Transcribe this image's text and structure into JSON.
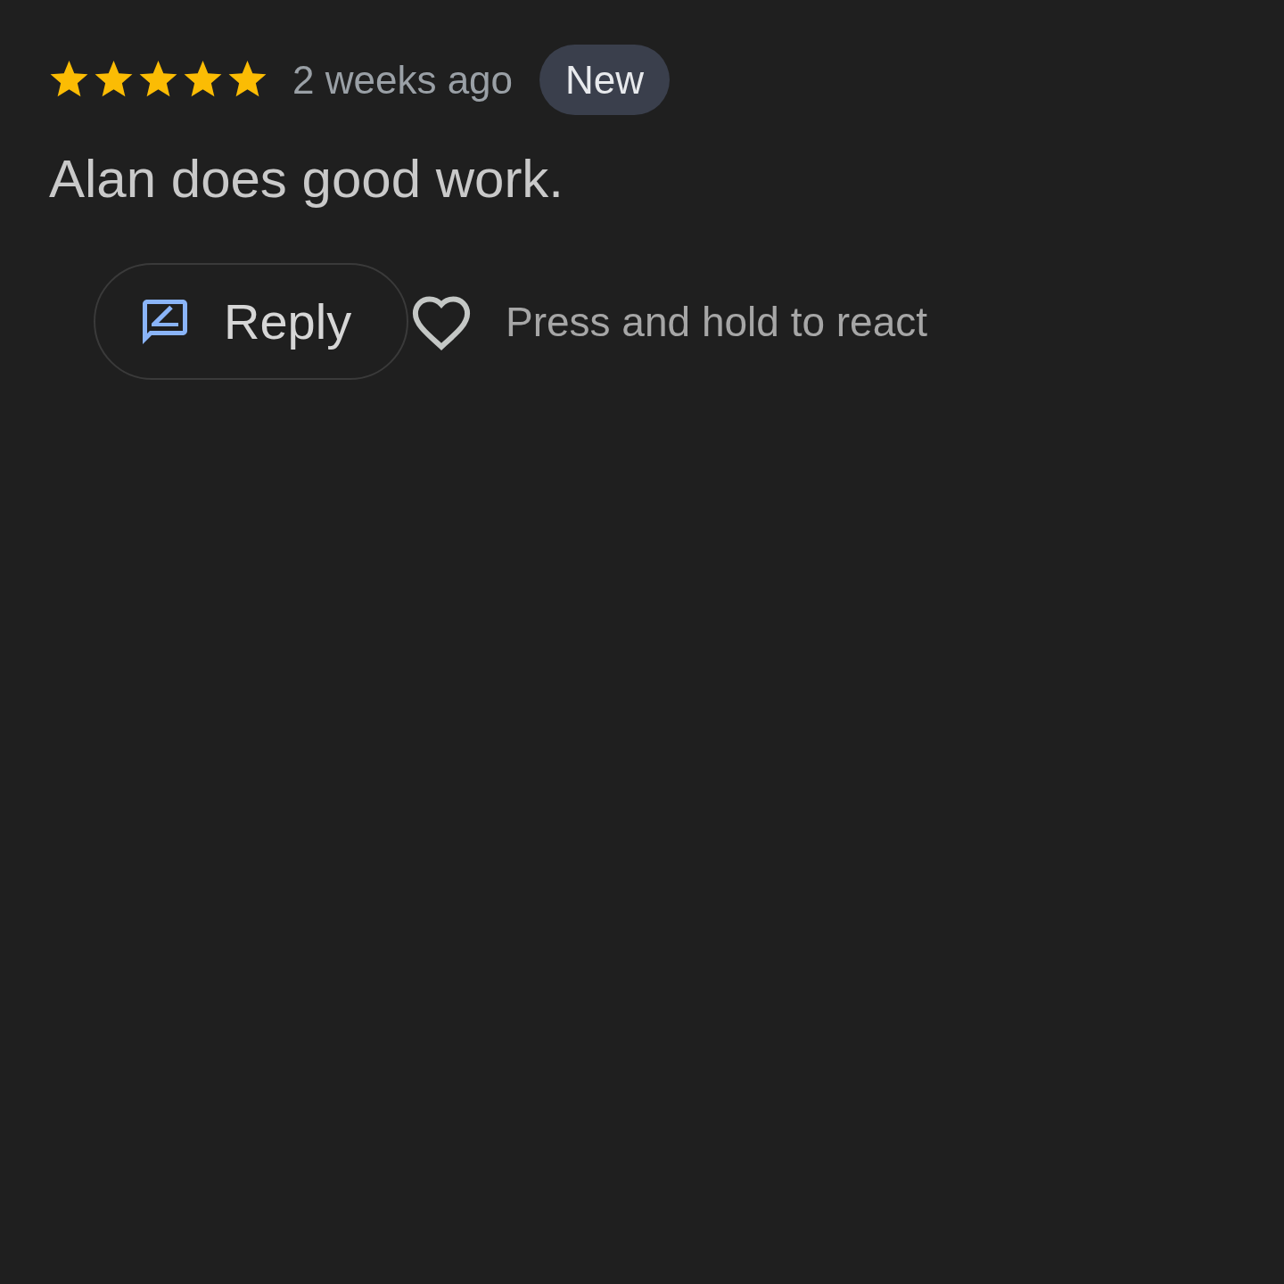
{
  "review": {
    "stars": 5,
    "time": "2 weeks ago",
    "badge": "New",
    "text": "Alan does good work."
  },
  "actions": {
    "reply": {
      "label": "Reply"
    },
    "react": {
      "hint": "Press and hold to react"
    }
  }
}
